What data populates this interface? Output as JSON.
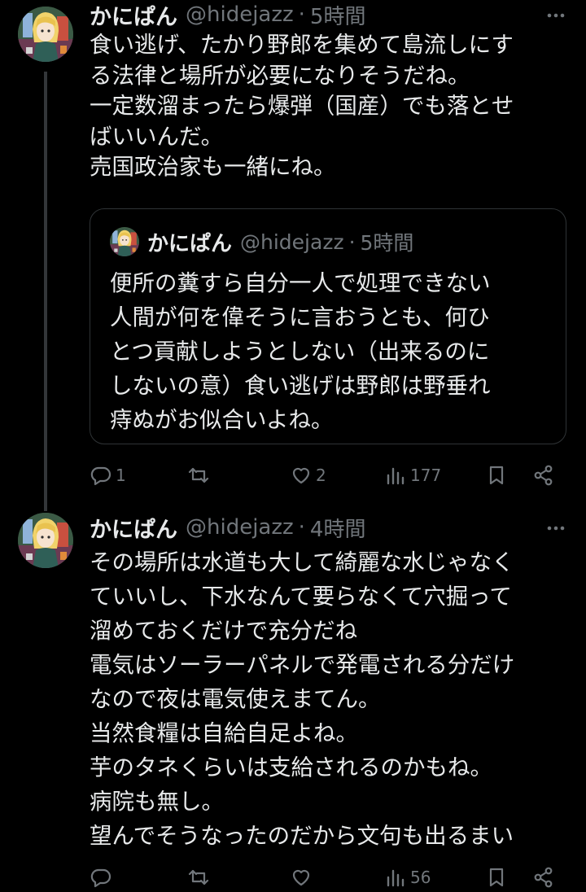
{
  "tweets": [
    {
      "name": "かにぱん",
      "handle": "@hidejazz",
      "dot": "·",
      "time": "5時間",
      "lines": [
        "食い逃げ、たかり野郎を集めて島流しにす",
        "る法律と場所が必要になりそうだね。",
        "一定数溜まったら爆弾（国産）でも落とせ",
        "ばいいんだ。",
        "売国政治家も一緒にね。"
      ],
      "quote": {
        "name": "かにぱん",
        "handle": "@hidejazz",
        "dot": "·",
        "time": "5時間",
        "lines": [
          "便所の糞すら自分一人で処理できない",
          "人間が何を偉そうに言おうとも、何ひ",
          "とつ貢献しようとしない（出来るのに",
          "しないの意）食い逃げは野郎は野垂れ",
          "痔ぬがお似合いよね。"
        ]
      },
      "replies": "1",
      "retweets": "",
      "likes": "2",
      "views": "177"
    },
    {
      "name": "かにぱん",
      "handle": "@hidejazz",
      "dot": "·",
      "time": "4時間",
      "lines": [
        "その場所は水道も大して綺麗な水じゃなく",
        "ていいし、下水なんて要らなくて穴掘って",
        "溜めておくだけで充分だね",
        "電気はソーラーパネルで発電される分だけ",
        "なので夜は電気使えまてん。",
        "当然食糧は自給自足よね。",
        "芋のタネくらいは支給されるのかもね。",
        "病院も無し。",
        "望んでそうなったのだから文句も出るまい"
      ],
      "replies": "",
      "retweets": "",
      "likes": "",
      "views": "56"
    }
  ],
  "icons": [
    "more-icon",
    "reply-icon",
    "retweet-icon",
    "like-icon",
    "views-icon",
    "bookmark-icon",
    "share-icon"
  ],
  "colors": {
    "background": "#000000",
    "text": "#e7e9ea",
    "muted": "#71767b",
    "border": "#2f3336"
  }
}
